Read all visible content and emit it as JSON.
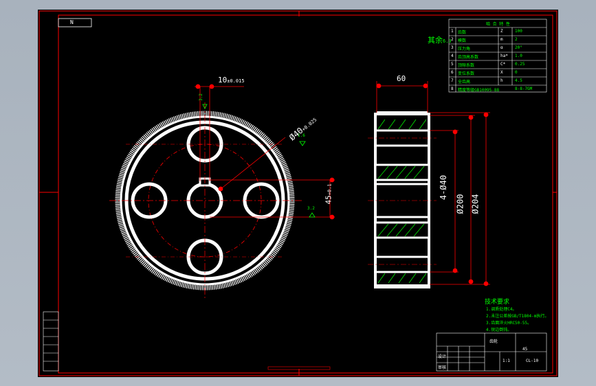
{
  "drawing": {
    "sheet_tag": "N",
    "roughness_other": "其余",
    "roughness_other_value": "6.3",
    "keyway_width": "10",
    "keyway_tol": "±0.015",
    "bore_dim": "Ø40",
    "bore_tol": "+0.025",
    "keyway_depth": "45",
    "keyway_depth_tol": "+0.1",
    "face_width": "60",
    "holes_dim": "4-Ø40",
    "root_dia": "Ø200",
    "tip_dia": "Ø204",
    "ra_keyway": "3.2",
    "ra_side": "3.2",
    "ra_bore": "1.6"
  },
  "param_table": {
    "title": "啮 合 特 性",
    "rows": [
      {
        "no": "1",
        "name": "齿数",
        "sym": "Z",
        "val": "100"
      },
      {
        "no": "2",
        "name": "模数",
        "sym": "m",
        "val": "2"
      },
      {
        "no": "3",
        "name": "压力角",
        "sym": "α",
        "val": "20°"
      },
      {
        "no": "4",
        "name": "齿顶高系数",
        "sym": "ha*",
        "val": "1.0"
      },
      {
        "no": "5",
        "name": "顶隙系数",
        "sym": "C*",
        "val": "0.25"
      },
      {
        "no": "6",
        "name": "变位系数",
        "sym": "X",
        "val": "0"
      },
      {
        "no": "7",
        "name": "全齿高",
        "sym": "h",
        "val": "4.5"
      },
      {
        "no": "8",
        "name": "精度等级GB10095-88",
        "sym": "",
        "val": "8-8-7GM"
      }
    ]
  },
  "tech_req": {
    "title": "技术要求",
    "lines": [
      "1.调质处理C4。",
      "2.未注公差按GB/T1804-m执行。",
      "3.齿面淬火HRC50-55。",
      "4.锐边倒钝。"
    ]
  },
  "title_block": {
    "part_name": "齿轮",
    "material": "45",
    "designer": "设计",
    "checker": "审核",
    "scale": "1:1",
    "drawing_no": "CL-10"
  },
  "colors": {
    "background": "#000000",
    "frame_red": "#ff0000",
    "geometry_white": "#ffffff",
    "text_green": "#00ff00",
    "hatch_green": "#00ff00"
  }
}
